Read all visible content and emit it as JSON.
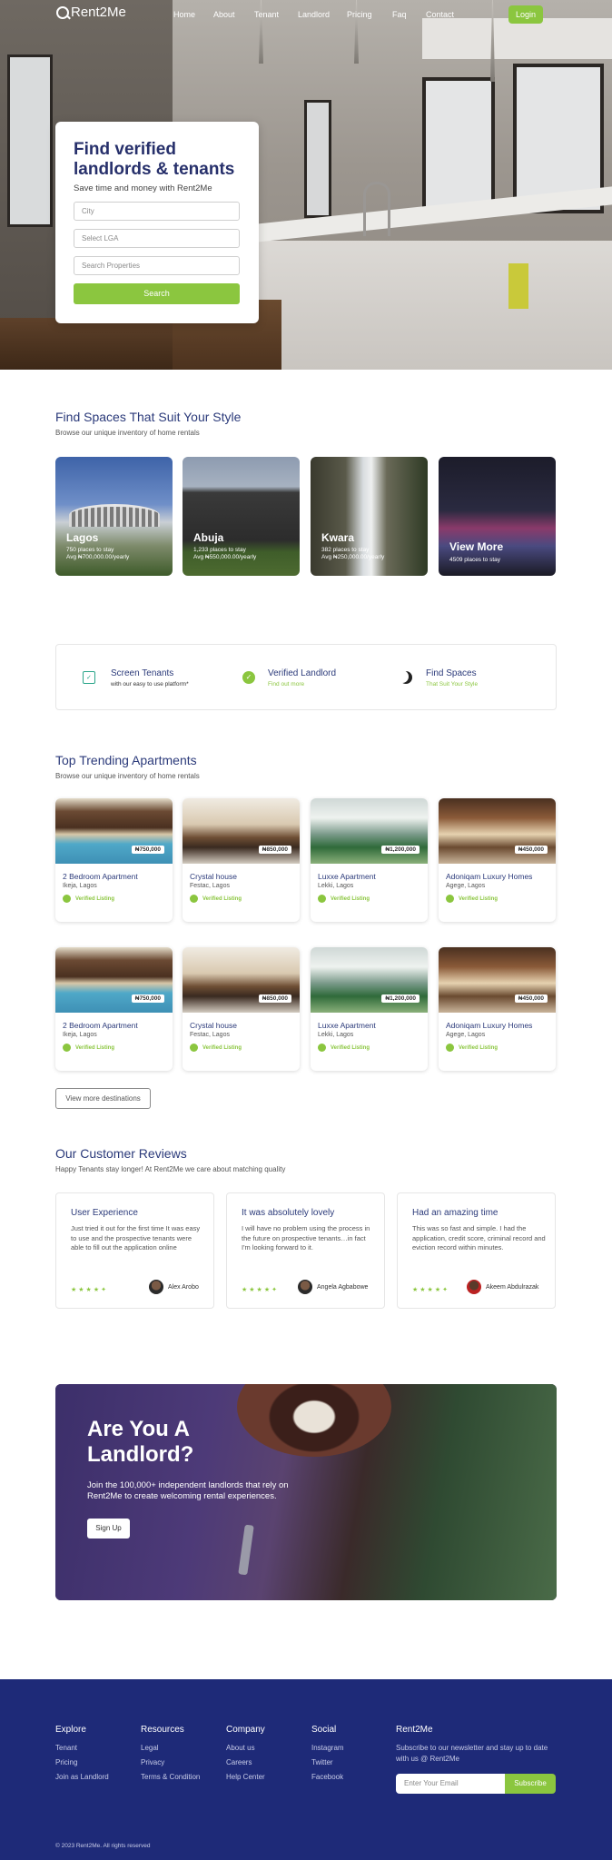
{
  "nav": {
    "logo": "Rent2Me",
    "links": [
      "Home",
      "About",
      "Tenant",
      "Landlord",
      "Pricing",
      "Faq",
      "Contact"
    ],
    "login": "Login"
  },
  "hero": {
    "title": "Find verified landlords & tenants",
    "subtitle": "Save time and money with Rent2Me",
    "city_placeholder": "City",
    "lga_placeholder": "Select LGA",
    "search_placeholder": "Search Properties",
    "search_button": "Search"
  },
  "spaces": {
    "title": "Find Spaces That Suit Your Style",
    "subtitle": "Browse our unique inventory of home rentals",
    "cities": [
      {
        "name": "Lagos",
        "places": "750 places to stay",
        "avg": "Avg ₦700,000.00/yearly"
      },
      {
        "name": "Abuja",
        "places": "1,233 places to stay",
        "avg": "Avg ₦550,000.00/yearly"
      },
      {
        "name": "Kwara",
        "places": "382 places to stay",
        "avg": "Avg ₦250,000.00/yearly"
      },
      {
        "name": "View More",
        "places": "4509 places to stay",
        "avg": ""
      }
    ]
  },
  "features": [
    {
      "title": "Screen Tenants",
      "subtitle": "with our easy to use platform*",
      "icon": "calendar-check-icon"
    },
    {
      "title": "Verified Landlord",
      "subtitle": "Find out more",
      "icon": "check-circle-icon"
    },
    {
      "title": "Find Spaces",
      "subtitle": "That Suit Your Style",
      "icon": "moon-icon"
    }
  ],
  "trending": {
    "title": "Top Trending Apartments",
    "subtitle": "Browse our unique inventory of home rentals",
    "verified_label": "Verified Listing",
    "apartments": [
      {
        "name": "2 Bedroom Apartment",
        "location": "Ikeja, Lagos",
        "price": "₦750,000"
      },
      {
        "name": "Crystal house",
        "location": "Festac, Lagos",
        "price": "₦850,000"
      },
      {
        "name": "Luxxe Apartment",
        "location": "Lekki, Lagos",
        "price": "₦1,200,000"
      },
      {
        "name": "Adoniqam Luxury Homes",
        "location": "Agege, Lagos",
        "price": "₦450,000"
      },
      {
        "name": "2 Bedroom Apartment",
        "location": "Ikeja, Lagos",
        "price": "₦750,000"
      },
      {
        "name": "Crystal house",
        "location": "Festac, Lagos",
        "price": "₦850,000"
      },
      {
        "name": "Luxxe Apartment",
        "location": "Lekki, Lagos",
        "price": "₦1,200,000"
      },
      {
        "name": "Adoniqam Luxury Homes",
        "location": "Agege, Lagos",
        "price": "₦450,000"
      }
    ],
    "view_more": "View more destinations"
  },
  "reviews": {
    "title": "Our Customer Reviews",
    "subtitle": "Happy Tenants stay longer! At Rent2Me we care about matching quality",
    "items": [
      {
        "title": "User Experience",
        "body": "Just tried it out for the first time It was easy to use and the prospective tenants were able to fill out the application online",
        "author": "Alex Arobo",
        "stars": "★★★★✦"
      },
      {
        "title": "It was absolutely lovely",
        "body": "I will have no problem using the process in the future on prospective tenants…in fact I'm looking forward to it.",
        "author": "Angela Agbabowe",
        "stars": "★★★★✦"
      },
      {
        "title": "Had an amazing time",
        "body": "This was so fast and simple. I had the application, credit score, criminal record and eviction record within minutes.",
        "author": "Akeem Abdulrazak",
        "stars": "★★★★✦"
      }
    ]
  },
  "landlord": {
    "title": "Are You A Landlord?",
    "body": "Join the 100,000+ independent landlords that rely on Rent2Me to create welcoming rental experiences.",
    "button": "Sign Up"
  },
  "footer": {
    "columns": [
      {
        "heading": "Explore",
        "links": [
          "Tenant",
          "Pricing",
          "Join as Landlord"
        ]
      },
      {
        "heading": "Resources",
        "links": [
          "Legal",
          "Privacy",
          "Terms & Condition"
        ]
      },
      {
        "heading": "Company",
        "links": [
          "About us",
          "Careers",
          "Help Center"
        ]
      },
      {
        "heading": "Social",
        "links": [
          "Instagram",
          "Twitter",
          "Facebook"
        ]
      }
    ],
    "brand": "Rent2Me",
    "newsletter": "Subscribe to our newsletter and stay up to date with us @ Rent2Me",
    "email_placeholder": "Enter Your Email",
    "subscribe": "Subscribe",
    "copyright": "© 2023 Rent2Me. All rights reserved"
  },
  "colors": {
    "accent": "#8bc63f",
    "navy": "#1e2a78",
    "heading": "#2b3a7a"
  }
}
